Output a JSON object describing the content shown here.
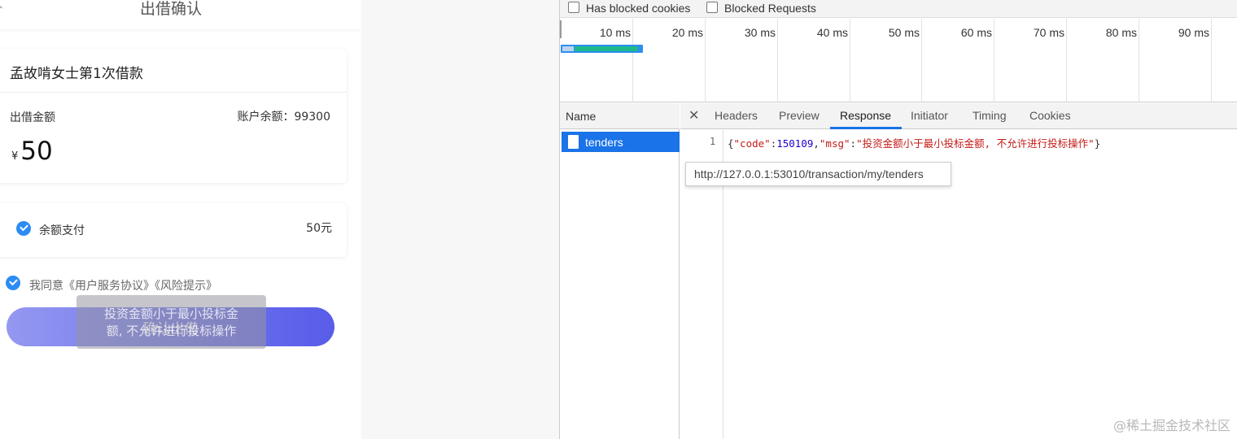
{
  "app": {
    "title": "出借确认",
    "loan_title": "孟故啃女士第1次借款",
    "amount_label": "出借金额",
    "balance_text": "账户余额：99300",
    "currency": "¥",
    "amount": "50",
    "pay_method": "余额支付",
    "pay_amount": "50元",
    "agreement": "我同意《用户服务协议》《风险提示》",
    "confirm_button": "确认出借",
    "toast_line1": "投资金额小于最小投标金",
    "toast_line2": "额, 不允许进行投标操作"
  },
  "devtools": {
    "filters": {
      "blocked_cookies": "Has blocked cookies",
      "blocked_requests": "Blocked Requests"
    },
    "timeline_ticks": [
      "10 ms",
      "20 ms",
      "30 ms",
      "40 ms",
      "50 ms",
      "60 ms",
      "70 ms",
      "80 ms",
      "90 ms"
    ],
    "name_header": "Name",
    "request_name": "tenders",
    "tabs": [
      "Headers",
      "Preview",
      "Response",
      "Initiator",
      "Timing",
      "Cookies"
    ],
    "active_tab": "Response",
    "response": {
      "line_number": "1",
      "code_key": "\"code\"",
      "code_value": "150109",
      "msg_key": "\"msg\"",
      "msg_value": "\"投资金额小于最小投标金额, 不允许进行投标操作\""
    },
    "url_tooltip": "http://127.0.0.1:53010/transaction/my/tenders",
    "colors": {
      "selected_row": "#1a73e8",
      "timing_bar": "#2d8ef0",
      "timing_receive": "#1fb88a"
    }
  },
  "watermark": "@稀土掘金技术社区"
}
